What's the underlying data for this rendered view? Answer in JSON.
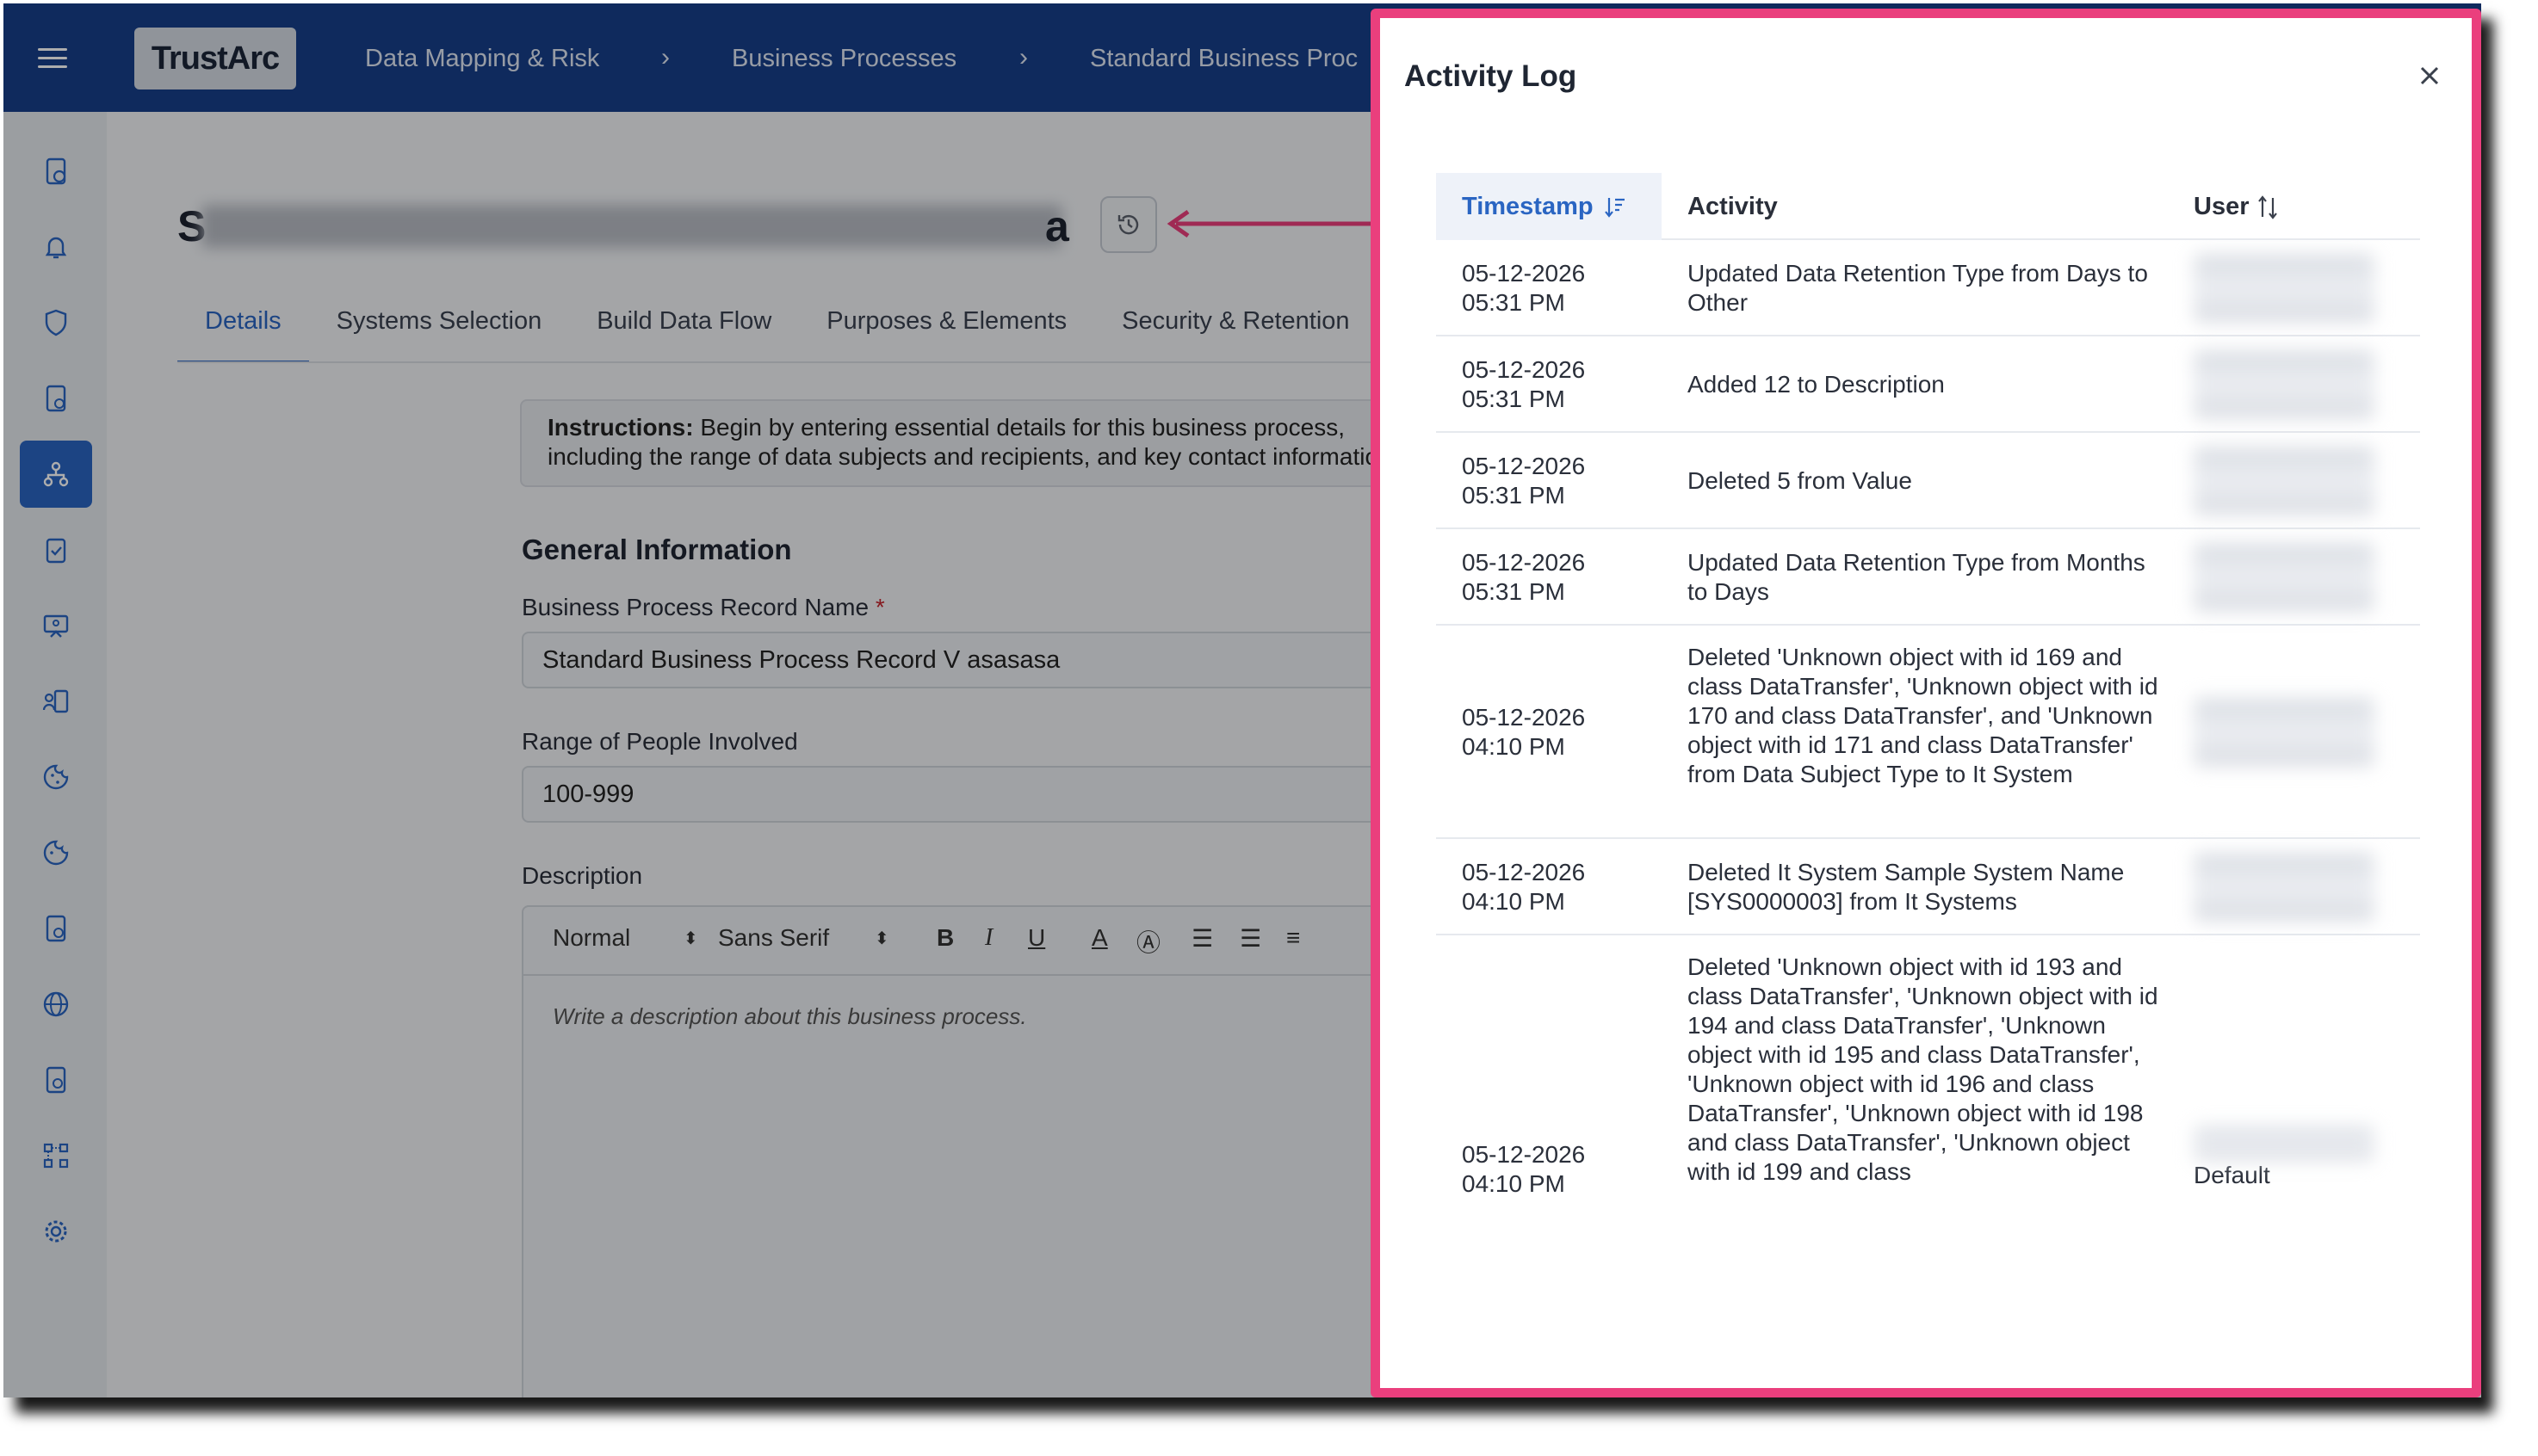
{
  "topbar": {
    "logo": "TrustArc",
    "breadcrumbs": [
      "Data Mapping & Risk",
      "Business Processes",
      "Standard Business Proc"
    ]
  },
  "page": {
    "title_start": "S",
    "title_end": "a"
  },
  "tabs": [
    "Details",
    "Systems Selection",
    "Build Data Flow",
    "Purposes & Elements",
    "Security & Retention"
  ],
  "instructions": {
    "label": "Instructions:",
    "text": " Begin by entering essential details for this business process, including the range of data subjects and recipients, and key contact information."
  },
  "form": {
    "section_title": "General Information",
    "record_name_label": "Business Process Record Name",
    "required_mark": "*",
    "record_name_value": "Standard Business Process Record V asasasa",
    "range_label": "Range of People Involved",
    "range_value": "100-999",
    "description_label": "Description",
    "editor_format": "Normal",
    "editor_font": "Sans Serif",
    "editor_placeholder": "Write a description about this business process."
  },
  "activity_log": {
    "title": "Activity Log",
    "columns": {
      "timestamp": "Timestamp",
      "activity": "Activity",
      "user": "User"
    },
    "rows": [
      {
        "date": "05-12-2026",
        "time": "05:31 PM",
        "activity": "Updated Data Retention Type from Days to Other",
        "user": ""
      },
      {
        "date": "05-12-2026",
        "time": "05:31 PM",
        "activity": "Added 12 to Description",
        "user": ""
      },
      {
        "date": "05-12-2026",
        "time": "05:31 PM",
        "activity": "Deleted 5 from Value",
        "user": ""
      },
      {
        "date": "05-12-2026",
        "time": "05:31 PM",
        "activity": "Updated Data Retention Type from Months to Days",
        "user": ""
      },
      {
        "date": "05-12-2026",
        "time": "04:10 PM",
        "activity": "Deleted 'Unknown object with id 169 and class DataTransfer', 'Unknown object with id 170 and class DataTransfer', and 'Unknown object with id 171 and class DataTransfer' from Data Subject Type to It System",
        "user": ""
      },
      {
        "date": "05-12-2026",
        "time": "04:10 PM",
        "activity": "Deleted It System Sample System Name [SYS0000003] from It Systems",
        "user": ""
      },
      {
        "date": "05-12-2026",
        "time": "04:10 PM",
        "activity": "Deleted 'Unknown object with id 193 and class DataTransfer', 'Unknown object with id 194 and class DataTransfer', 'Unknown object with id 195 and class DataTransfer', 'Unknown object with id 196 and class DataTransfer', 'Unknown object with id 198 and class DataTransfer', 'Unknown object with id 199 and class",
        "user": "Default"
      }
    ]
  },
  "colors": {
    "topbar": "#173f8a",
    "accent": "#2a65c2",
    "highlight_border": "#ea3f7d"
  }
}
